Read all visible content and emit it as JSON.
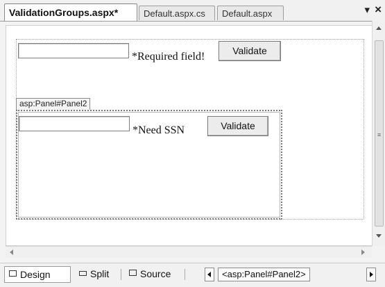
{
  "tabs": [
    {
      "label": "ValidationGroups.aspx*",
      "active": true
    },
    {
      "label": "Default.aspx.cs",
      "active": false
    },
    {
      "label": "Default.aspx",
      "active": false
    }
  ],
  "window_controls": {
    "pin": "▾",
    "close": "×"
  },
  "panel1": {
    "required_label": "*Required field!",
    "validate_label": "Validate"
  },
  "panel2": {
    "tag": "asp:Panel#Panel2",
    "ssn_label": "*Need SSN",
    "validate_label": "Validate"
  },
  "view_buttons": [
    {
      "label": "Design",
      "active": true
    },
    {
      "label": "Split",
      "active": false
    },
    {
      "label": "Source",
      "active": false
    }
  ],
  "breadcrumb": "<asp:Panel#Panel2>"
}
